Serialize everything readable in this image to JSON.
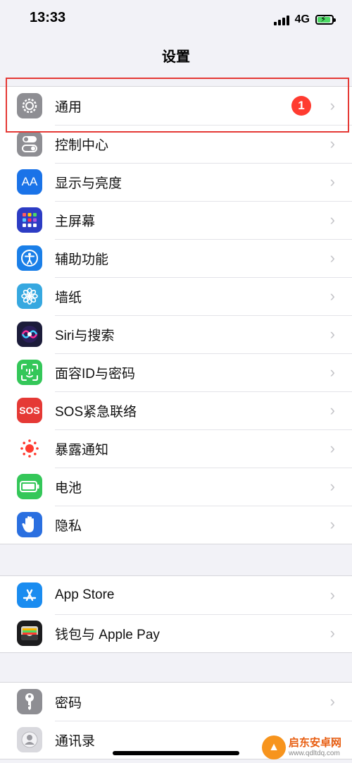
{
  "status": {
    "time": "13:33",
    "network": "4G"
  },
  "nav": {
    "title": "设置"
  },
  "groups": [
    {
      "items": [
        {
          "label": "通用",
          "icon": "gear-icon",
          "color": "#8e8e93",
          "badge": "1"
        },
        {
          "label": "控制中心",
          "icon": "toggle-icon",
          "color": "#8e8e93"
        },
        {
          "label": "显示与亮度",
          "icon": "text-size-icon",
          "color": "#1a73e8"
        },
        {
          "label": "主屏幕",
          "icon": "home-grid-icon",
          "color": "#2c3cc4"
        },
        {
          "label": "辅助功能",
          "icon": "accessibility-icon",
          "color": "#1a7fe8"
        },
        {
          "label": "墙纸",
          "icon": "flower-icon",
          "color": "#36a8e0"
        },
        {
          "label": "Siri与搜索",
          "icon": "siri-icon",
          "color": "#1c1c3a"
        },
        {
          "label": "面容ID与密码",
          "icon": "face-id-icon",
          "color": "#34c759"
        },
        {
          "label": "SOS紧急联络",
          "icon": "sos-icon",
          "color": "#e53935",
          "icon_text": "SOS"
        },
        {
          "label": "暴露通知",
          "icon": "exposure-icon",
          "color": "#ffffff"
        },
        {
          "label": "电池",
          "icon": "battery-icon",
          "color": "#34c759"
        },
        {
          "label": "隐私",
          "icon": "hand-icon",
          "color": "#2a6fe0"
        }
      ]
    },
    {
      "items": [
        {
          "label": "App Store",
          "icon": "app-store-icon",
          "color": "#1a8cf0"
        },
        {
          "label": "钱包与 Apple Pay",
          "icon": "wallet-icon",
          "color": "#1c1c1e"
        }
      ]
    },
    {
      "items": [
        {
          "label": "密码",
          "icon": "key-icon",
          "color": "#8e8e93"
        },
        {
          "label": "通讯录",
          "icon": "contacts-icon",
          "color": "#d9d9de"
        }
      ]
    }
  ],
  "watermark": {
    "name": "启东安卓网",
    "url": "www.qdltdq.com"
  }
}
